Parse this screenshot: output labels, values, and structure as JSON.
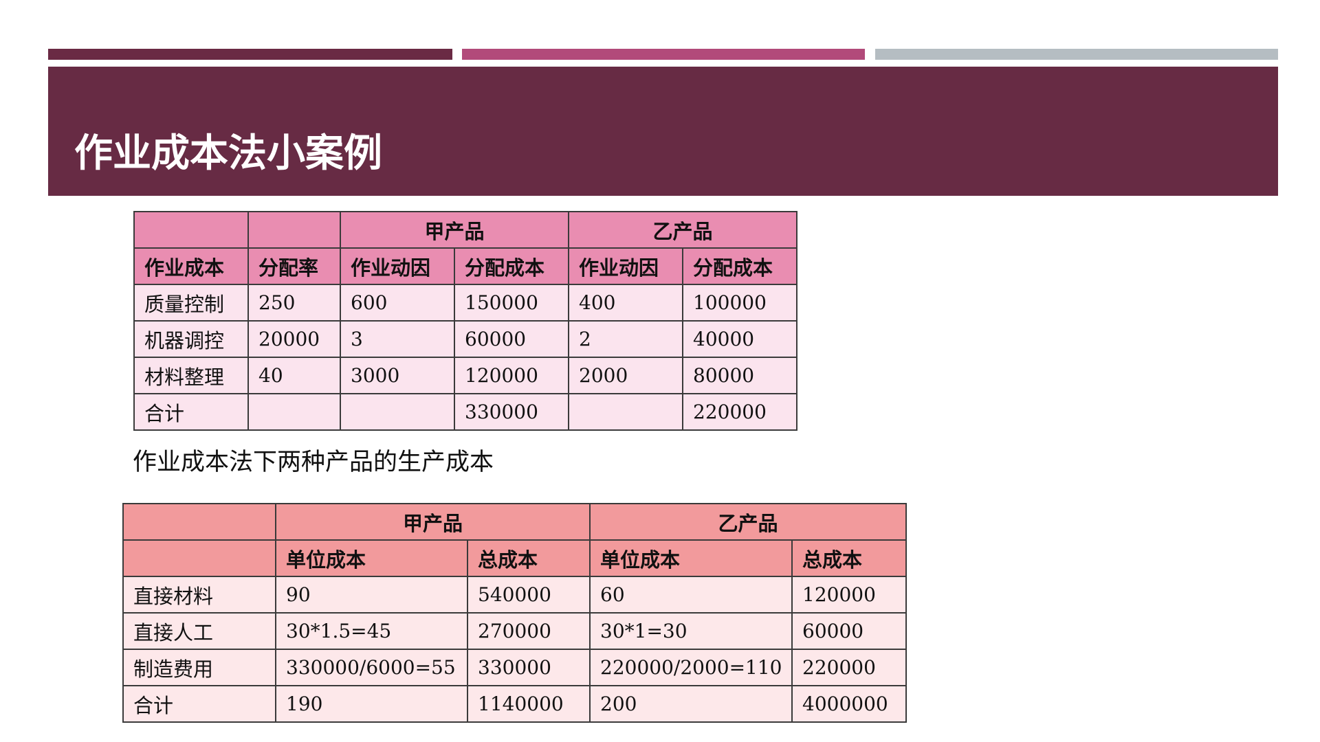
{
  "slide": {
    "title": "作业成本法小案例",
    "subtitle": "作业成本法下两种产品的生产成本"
  },
  "table1": {
    "group_headers": [
      "",
      "",
      "甲产品",
      "乙产品"
    ],
    "headers": [
      "作业成本",
      "分配率",
      "作业动因",
      "分配成本",
      "作业动因",
      "分配成本"
    ],
    "rows": [
      [
        "质量控制",
        "250",
        "600",
        "150000",
        "400",
        "100000"
      ],
      [
        "机器调控",
        "20000",
        "3",
        "60000",
        "2",
        "40000"
      ],
      [
        "材料整理",
        "40",
        "3000",
        "120000",
        "2000",
        "80000"
      ],
      [
        "合计",
        "",
        "",
        "330000",
        "",
        "220000"
      ]
    ]
  },
  "table2": {
    "group_headers": [
      "",
      "甲产品",
      "乙产品"
    ],
    "headers": [
      "",
      "单位成本",
      "总成本",
      "单位成本",
      "总成本"
    ],
    "rows": [
      [
        "直接材料",
        "90",
        "540000",
        "60",
        "120000"
      ],
      [
        "直接人工",
        "30*1.5=45",
        "270000",
        "30*1=30",
        "60000"
      ],
      [
        "制造费用",
        "330000/6000=55",
        "330000",
        "220000/2000=110",
        "220000"
      ],
      [
        "合计",
        "190",
        "1140000",
        "200",
        "4000000"
      ]
    ]
  },
  "colors": {
    "banner": "#672b44",
    "accent_bar_1": "#6a2a44",
    "accent_bar_2": "#b24a7a",
    "accent_bar_3": "#b5bdc2",
    "table1_header": "#e98db1",
    "table1_body": "#fbe4ee",
    "table2_header": "#f29a9c",
    "table2_body": "#fde8ea"
  }
}
